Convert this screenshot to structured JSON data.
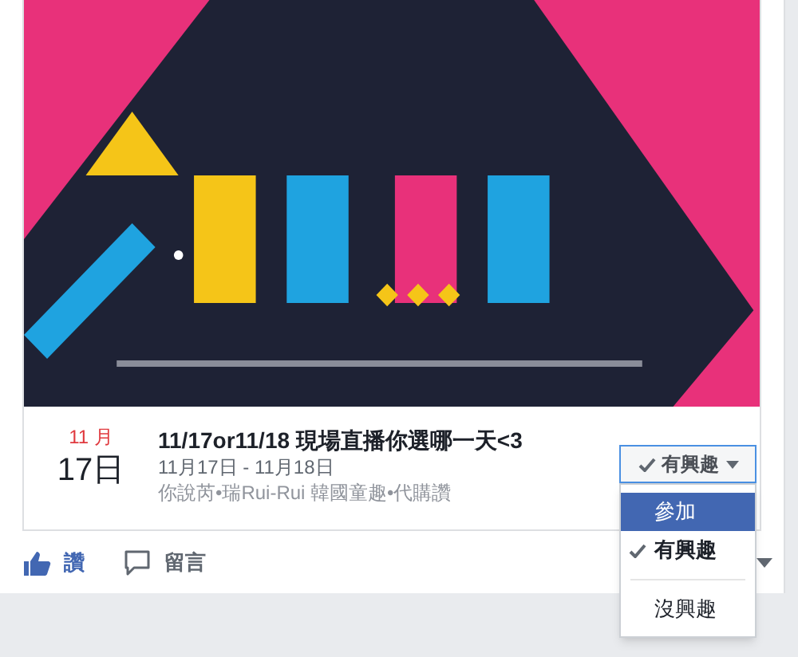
{
  "event": {
    "month": "11 月",
    "day": "17日",
    "title": "11/17or11/18 現場直播你選哪一天<3",
    "dates": "11月17日 - 11月18日",
    "host": "你說芮•瑞Rui-Rui 韓國童趣•代購讚",
    "rsvp": {
      "label": "有興趣",
      "expanded": true,
      "options": [
        {
          "label": "參加",
          "highlighted": true,
          "selected": false
        },
        {
          "label": "有興趣",
          "highlighted": false,
          "selected": true
        },
        {
          "label": "沒興趣",
          "highlighted": false,
          "selected": false
        }
      ]
    }
  },
  "actions": [
    {
      "kind": "like",
      "label": "讚"
    },
    {
      "kind": "comment",
      "label": "留言"
    }
  ]
}
